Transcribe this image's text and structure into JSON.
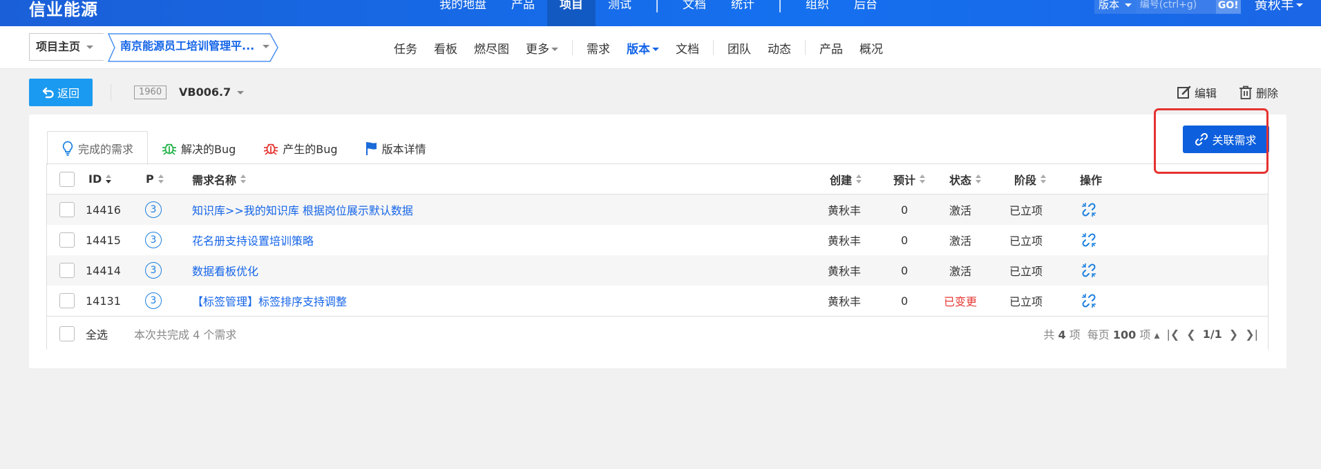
{
  "header": {
    "brand": "信业能源",
    "nav": [
      {
        "label": "我的地盘",
        "active": false
      },
      {
        "label": "产品",
        "active": false
      },
      {
        "label": "项目",
        "active": true
      },
      {
        "label": "测试",
        "active": false
      },
      {
        "label": "文档",
        "active": false
      },
      {
        "label": "统计",
        "active": false
      },
      {
        "label": "组织",
        "active": false
      },
      {
        "label": "后台",
        "active": false
      }
    ],
    "search_type": "版本",
    "search_placeholder": "编号(ctrl+g)",
    "go_label": "GO!",
    "user": "黄秋丰"
  },
  "subbar": {
    "home_label": "项目主页",
    "project_label": "南京能源员工培训管理平...",
    "nav": [
      {
        "label": "任务"
      },
      {
        "label": "看板"
      },
      {
        "label": "燃尽图"
      },
      {
        "label": "更多"
      },
      {
        "label": "需求"
      },
      {
        "label": "版本"
      },
      {
        "label": "文档"
      },
      {
        "label": "团队"
      },
      {
        "label": "动态"
      },
      {
        "label": "产品"
      },
      {
        "label": "概况"
      }
    ]
  },
  "toolbar": {
    "back_label": "返回",
    "version_id": "1960",
    "version_name": "VB006.7",
    "edit_label": "编辑",
    "delete_label": "删除"
  },
  "tabs": [
    {
      "label": "完成的需求",
      "icon": "lightbulb-icon",
      "active": true
    },
    {
      "label": "解决的Bug",
      "icon": "bug-icon-green",
      "active": false
    },
    {
      "label": "产生的Bug",
      "icon": "bug-icon-red",
      "active": false
    },
    {
      "label": "版本详情",
      "icon": "flag-icon",
      "active": false
    }
  ],
  "link_story_label": "关联需求",
  "table": {
    "headers": {
      "id": "ID",
      "pri": "P",
      "name": "需求名称",
      "creator": "创建",
      "estimate": "预计",
      "status": "状态",
      "stage": "阶段",
      "action": "操作"
    },
    "rows": [
      {
        "id": "14416",
        "pri": "3",
        "name": "知识库>>我的知识库 根据岗位展示默认数据",
        "creator": "黄秋丰",
        "estimate": "0",
        "status": "激活",
        "stage": "已立项"
      },
      {
        "id": "14415",
        "pri": "3",
        "name": "花名册支持设置培训策略",
        "creator": "黄秋丰",
        "estimate": "0",
        "status": "激活",
        "stage": "已立项"
      },
      {
        "id": "14414",
        "pri": "3",
        "name": "数据看板优化",
        "creator": "黄秋丰",
        "estimate": "0",
        "status": "激活",
        "stage": "已立项"
      },
      {
        "id": "14131",
        "pri": "3",
        "name": "【标签管理】标签排序支持调整",
        "creator": "黄秋丰",
        "estimate": "0",
        "status": "已变更",
        "stage": "已立项"
      }
    ],
    "footer": {
      "select_all": "全选",
      "summary": "本次共完成 4 个需求",
      "total_prefix": "共",
      "total_count": "4",
      "total_suffix": "项",
      "per_page_prefix": "每页",
      "per_page": "100",
      "per_page_suffix": "项",
      "page": "1/1"
    }
  },
  "colors": {
    "primary": "#1565e8",
    "header": "#1570ef",
    "back_btn": "#1a9af0",
    "highlight": "#e5322f",
    "changed": "#e53935"
  }
}
